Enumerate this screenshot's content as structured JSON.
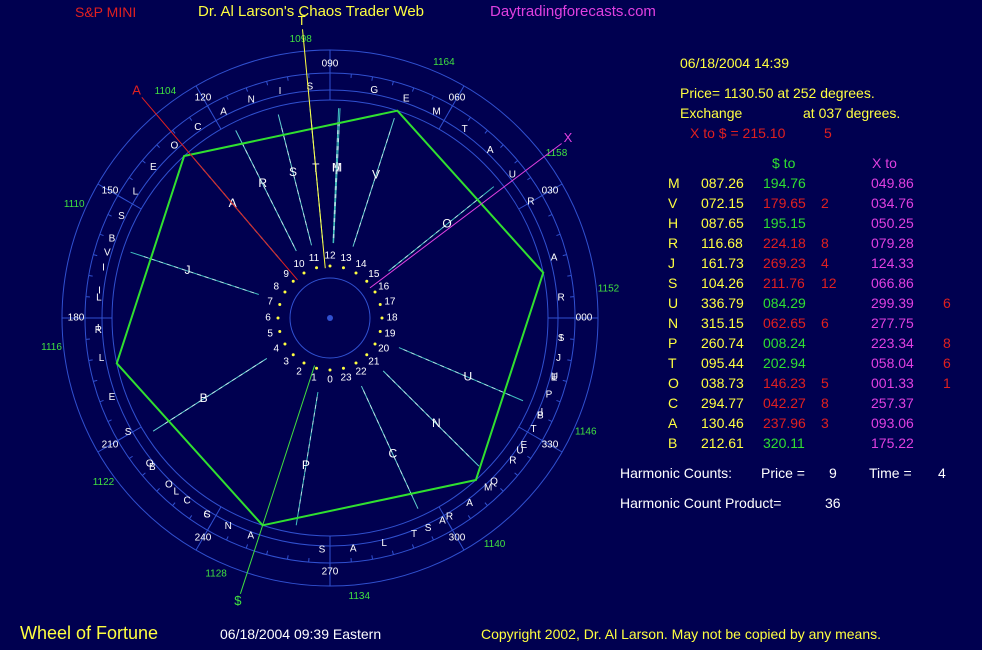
{
  "header": {
    "left": "S&P MINI",
    "center": "Dr. Al Larson's Chaos Trader Web",
    "right": "Daytradingforecasts.com"
  },
  "info": {
    "datetime": "06/18/2004 14:39",
    "price_line": "Price= 1130.50 at 252 degrees.",
    "exchange_label": "Exchange",
    "exchange_deg": "at 037 degrees.",
    "xto_line": "X to $  = 215.10",
    "xto_count": "5"
  },
  "table": {
    "col_dollar": "$ to",
    "col_x": "X to",
    "rows": [
      {
        "p": "M",
        "pos": "087.26",
        "d": "194.76",
        "dc": "",
        "dcol": "green",
        "x": "049.86",
        "xc": "",
        "xcol": "magenta"
      },
      {
        "p": "V",
        "pos": "072.15",
        "d": "179.65",
        "dc": "2",
        "dcol": "red",
        "x": "034.76",
        "xc": "",
        "xcol": "magenta"
      },
      {
        "p": "H",
        "pos": "087.65",
        "d": "195.15",
        "dc": "",
        "dcol": "green",
        "x": "050.25",
        "xc": "",
        "xcol": "magenta"
      },
      {
        "p": "R",
        "pos": "116.68",
        "d": "224.18",
        "dc": "8",
        "dcol": "red",
        "x": "079.28",
        "xc": "",
        "xcol": "magenta"
      },
      {
        "p": "J",
        "pos": "161.73",
        "d": "269.23",
        "dc": "4",
        "dcol": "red",
        "x": "124.33",
        "xc": "",
        "xcol": "magenta"
      },
      {
        "p": "S",
        "pos": "104.26",
        "d": "211.76",
        "dc": "12",
        "dcol": "red",
        "x": "066.86",
        "xc": "",
        "xcol": "magenta"
      },
      {
        "p": "U",
        "pos": "336.79",
        "d": "084.29",
        "dc": "",
        "dcol": "green",
        "x": "299.39",
        "xc": "6",
        "xcol": "red"
      },
      {
        "p": "N",
        "pos": "315.15",
        "d": "062.65",
        "dc": "6",
        "dcol": "red",
        "x": "277.75",
        "xc": "",
        "xcol": "magenta"
      },
      {
        "p": "P",
        "pos": "260.74",
        "d": "008.24",
        "dc": "",
        "dcol": "green",
        "x": "223.34",
        "xc": "8",
        "xcol": "red"
      },
      {
        "p": "T",
        "pos": "095.44",
        "d": "202.94",
        "dc": "",
        "dcol": "green",
        "x": "058.04",
        "xc": "6",
        "xcol": "red"
      },
      {
        "p": "O",
        "pos": "038.73",
        "d": "146.23",
        "dc": "5",
        "dcol": "red",
        "x": "001.33",
        "xc": "1",
        "xcol": "red"
      },
      {
        "p": "C",
        "pos": "294.77",
        "d": "042.27",
        "dc": "8",
        "dcol": "red",
        "x": "257.37",
        "xc": "",
        "xcol": "magenta"
      },
      {
        "p": "A",
        "pos": "130.46",
        "d": "237.96",
        "dc": "3",
        "dcol": "red",
        "x": "093.06",
        "xc": "",
        "xcol": "magenta"
      },
      {
        "p": "B",
        "pos": "212.61",
        "d": "320.11",
        "dc": "",
        "dcol": "green",
        "x": "175.22",
        "xc": "",
        "xcol": "magenta"
      }
    ]
  },
  "harmonics": {
    "counts_label": "Harmonic Counts:",
    "price_label": "Price =",
    "price_val": "9",
    "time_label": "Time =",
    "time_val": "4",
    "product_label": "Harmonic Count Product=",
    "product_val": "36"
  },
  "footer": {
    "title": "Wheel of Fortune",
    "datetime": "06/18/2004 09:39 Eastern",
    "copyright": "Copyright 2002, Dr. Al Larson. May not be copied by any means."
  },
  "chart_data": {
    "type": "wheel",
    "degree_labels": [
      "000",
      "030",
      "060",
      "090",
      "120",
      "150",
      "180",
      "210",
      "240",
      "270",
      "300",
      "330"
    ],
    "price_labels": [
      {
        "deg": 0,
        "text": "1152"
      },
      {
        "deg": 30,
        "text": "1158"
      },
      {
        "deg": 60,
        "text": "1164"
      },
      {
        "deg": 90,
        "text": "1098"
      },
      {
        "deg": 120,
        "text": "1104"
      },
      {
        "deg": 150,
        "text": "1110"
      },
      {
        "deg": 180,
        "text": "1116"
      },
      {
        "deg": 210,
        "text": "1122"
      },
      {
        "deg": 240,
        "text": "1128"
      },
      {
        "deg": 270,
        "text": "1134"
      },
      {
        "deg": 300,
        "text": "1140"
      },
      {
        "deg": 330,
        "text": "1146"
      }
    ],
    "ring_words": [
      {
        "text": "JUPITER",
        "start": 350,
        "end": 322
      },
      {
        "text": "MARS",
        "start": 313,
        "end": 295
      },
      {
        "text": "ATLAS",
        "start": 299,
        "end": 268
      },
      {
        "text": "ANSCOB",
        "start": 250,
        "end": 220
      },
      {
        "text": "CLOSE",
        "start": 238,
        "end": 200
      },
      {
        "text": "LILIB",
        "start": 190,
        "end": 160
      },
      {
        "text": "RIVS",
        "start": 183,
        "end": 154
      },
      {
        "text": "LEOCANIS",
        "start": 147,
        "end": 95
      },
      {
        "text": "GEMTAUR",
        "start": 79,
        "end": 30
      },
      {
        "text": "ARIES",
        "start": 15,
        "end": -25
      },
      {
        "text": "SIPUQ",
        "start": 355,
        "end": 315
      }
    ],
    "planets": [
      {
        "p": "M",
        "deg": 87.26
      },
      {
        "p": "V",
        "deg": 72.15
      },
      {
        "p": "H",
        "deg": 87.65
      },
      {
        "p": "R",
        "deg": 116.68
      },
      {
        "p": "J",
        "deg": 161.73
      },
      {
        "p": "S",
        "deg": 104.26
      },
      {
        "p": "U",
        "deg": 336.79
      },
      {
        "p": "N",
        "deg": 315.15
      },
      {
        "p": "P",
        "deg": 260.74
      },
      {
        "p": "T",
        "deg": 95.44
      },
      {
        "p": "O",
        "deg": 38.73
      },
      {
        "p": "C",
        "deg": 294.77
      },
      {
        "p": "A",
        "deg": 130.46
      },
      {
        "p": "B",
        "deg": 212.61
      }
    ],
    "markers": [
      {
        "label": "$",
        "deg": 252
      },
      {
        "label": "X",
        "deg": 37
      },
      {
        "label": "A",
        "deg": 130.46
      },
      {
        "label": "T",
        "deg": 95.44
      }
    ],
    "hour_labels": [
      "0",
      "1",
      "2",
      "3",
      "4",
      "5",
      "6",
      "7",
      "8",
      "9",
      "10",
      "11",
      "12",
      "13",
      "14",
      "15",
      "16",
      "17",
      "18",
      "19",
      "20",
      "21",
      "22",
      "23"
    ],
    "hexagon_start_deg": 252,
    "colors": {
      "bg": "#000050",
      "ring": "#3050d0",
      "hexagon": "#30e030",
      "dollar": "#40e040",
      "x": "#e040e0",
      "a": "#e02020",
      "t": "#ffff40"
    }
  }
}
